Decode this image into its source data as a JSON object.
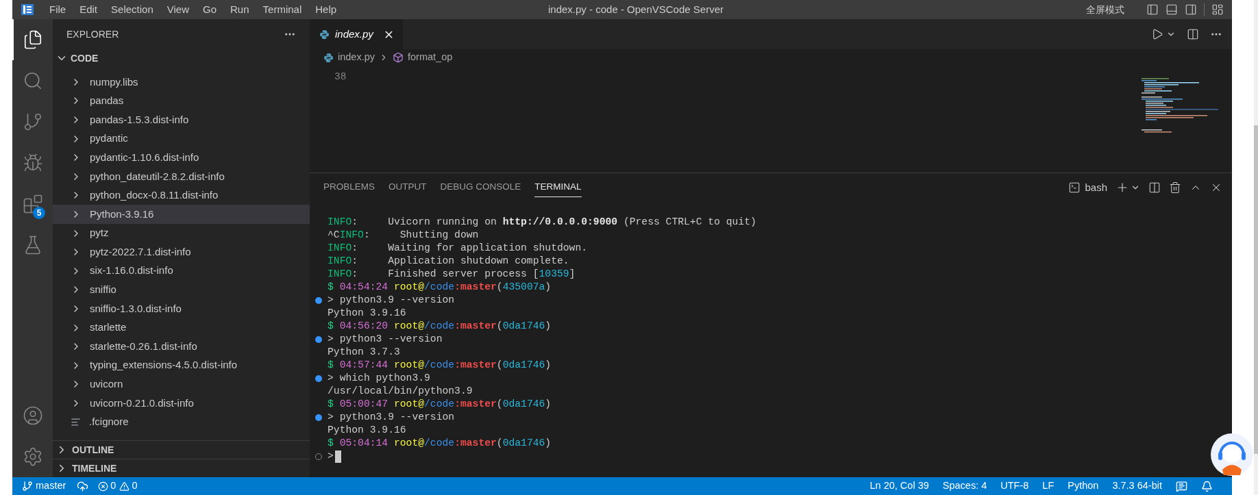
{
  "title_bar": {
    "menu": [
      "File",
      "Edit",
      "Selection",
      "View",
      "Go",
      "Run",
      "Terminal",
      "Help"
    ],
    "title": "index.py - code - OpenVSCode Server",
    "fullscreen_label": "全屏模式"
  },
  "activity_bar": {
    "items": [
      {
        "kind": "explorer",
        "selected": true
      },
      {
        "kind": "search",
        "selected": false
      },
      {
        "kind": "source-control",
        "selected": false
      },
      {
        "kind": "run-debug",
        "selected": false
      },
      {
        "kind": "extensions",
        "selected": false,
        "badge": "5"
      },
      {
        "kind": "testing",
        "selected": false
      }
    ],
    "bottom": [
      {
        "kind": "account"
      },
      {
        "kind": "settings"
      }
    ]
  },
  "sidebar": {
    "title": "EXPLORER",
    "section": "CODE",
    "items": [
      {
        "name": "numpy.libs",
        "kind": "folder",
        "selected": false
      },
      {
        "name": "pandas",
        "kind": "folder",
        "selected": false
      },
      {
        "name": "pandas-1.5.3.dist-info",
        "kind": "folder",
        "selected": false
      },
      {
        "name": "pydantic",
        "kind": "folder",
        "selected": false
      },
      {
        "name": "pydantic-1.10.6.dist-info",
        "kind": "folder",
        "selected": false
      },
      {
        "name": "python_dateutil-2.8.2.dist-info",
        "kind": "folder",
        "selected": false
      },
      {
        "name": "python_docx-0.8.11.dist-info",
        "kind": "folder",
        "selected": false
      },
      {
        "name": "Python-3.9.16",
        "kind": "folder",
        "selected": true
      },
      {
        "name": "pytz",
        "kind": "folder",
        "selected": false
      },
      {
        "name": "pytz-2022.7.1.dist-info",
        "kind": "folder",
        "selected": false
      },
      {
        "name": "six-1.16.0.dist-info",
        "kind": "folder",
        "selected": false
      },
      {
        "name": "sniffio",
        "kind": "folder",
        "selected": false
      },
      {
        "name": "sniffio-1.3.0.dist-info",
        "kind": "folder",
        "selected": false
      },
      {
        "name": "starlette",
        "kind": "folder",
        "selected": false
      },
      {
        "name": "starlette-0.26.1.dist-info",
        "kind": "folder",
        "selected": false
      },
      {
        "name": "typing_extensions-4.5.0.dist-info",
        "kind": "folder",
        "selected": false
      },
      {
        "name": "uvicorn",
        "kind": "folder",
        "selected": false
      },
      {
        "name": "uvicorn-0.21.0.dist-info",
        "kind": "folder",
        "selected": false
      },
      {
        "name": ".fcignore",
        "kind": "file",
        "selected": false
      }
    ],
    "collapsed_sections": [
      "OUTLINE",
      "TIMELINE"
    ]
  },
  "editor": {
    "tabs": [
      {
        "label": "index.py",
        "selected": true
      }
    ],
    "breadcrumb": [
      {
        "label": "index.py",
        "kind": "file"
      },
      {
        "label": "format_op",
        "kind": "symbol"
      }
    ],
    "line_number": "38"
  },
  "panel": {
    "tabs": [
      {
        "label": "PROBLEMS",
        "selected": false
      },
      {
        "label": "OUTPUT",
        "selected": false
      },
      {
        "label": "DEBUG CONSOLE",
        "selected": false
      },
      {
        "label": "TERMINAL",
        "selected": true
      }
    ],
    "terminal_name": "bash",
    "lines": [
      {
        "kind": "output",
        "segments": [
          {
            "text": "INFO",
            "color": "#0dbc79"
          },
          {
            "text": ":     Uvicorn running on ",
            "color": "#cccccc"
          },
          {
            "text": "http://0.0.0.0:9000",
            "color": "#e5e5e5",
            "bold": true
          },
          {
            "text": " (Press CTRL+C to quit)",
            "color": "#cccccc"
          }
        ]
      },
      {
        "kind": "output",
        "segments": [
          {
            "text": "^C",
            "color": "#cccccc"
          },
          {
            "text": "INFO",
            "color": "#0dbc79"
          },
          {
            "text": ":     Shutting down",
            "color": "#cccccc"
          }
        ]
      },
      {
        "kind": "output",
        "segments": [
          {
            "text": "INFO",
            "color": "#0dbc79"
          },
          {
            "text": ":     Waiting for application shutdown.",
            "color": "#cccccc"
          }
        ]
      },
      {
        "kind": "output",
        "segments": [
          {
            "text": "INFO",
            "color": "#0dbc79"
          },
          {
            "text": ":     Application shutdown complete.",
            "color": "#cccccc"
          }
        ]
      },
      {
        "kind": "output",
        "segments": [
          {
            "text": "INFO",
            "color": "#0dbc79"
          },
          {
            "text": ":     Finished server process [",
            "color": "#cccccc"
          },
          {
            "text": "10359",
            "color": "#29b8db"
          },
          {
            "text": "]",
            "color": "#cccccc"
          }
        ]
      },
      {
        "kind": "output",
        "segments": [
          {
            "text": "$ ",
            "color": "#23d18b"
          },
          {
            "text": "04:54:24 ",
            "color": "#d670d6"
          },
          {
            "text": "root@",
            "color": "#f5f543"
          },
          {
            "text": "/code",
            "color": "#3b8eea"
          },
          {
            "text": ":master",
            "color": "#f14c4c",
            "bold": true
          },
          {
            "text": "(",
            "color": "#cccccc"
          },
          {
            "text": "435007a",
            "color": "#29b8db"
          },
          {
            "text": ")",
            "color": "#cccccc"
          }
        ]
      },
      {
        "kind": "command",
        "segments": [
          {
            "text": "> python3.9 --version",
            "color": "#cccccc"
          }
        ]
      },
      {
        "kind": "output",
        "segments": [
          {
            "text": "Python 3.9.16",
            "color": "#cccccc"
          }
        ]
      },
      {
        "kind": "output",
        "segments": [
          {
            "text": "$ ",
            "color": "#23d18b"
          },
          {
            "text": "04:56:20 ",
            "color": "#d670d6"
          },
          {
            "text": "root@",
            "color": "#f5f543"
          },
          {
            "text": "/code",
            "color": "#3b8eea"
          },
          {
            "text": ":master",
            "color": "#f14c4c",
            "bold": true
          },
          {
            "text": "(",
            "color": "#cccccc"
          },
          {
            "text": "0da1746",
            "color": "#29b8db"
          },
          {
            "text": ")",
            "color": "#cccccc"
          }
        ]
      },
      {
        "kind": "command",
        "segments": [
          {
            "text": "> python3 --version",
            "color": "#cccccc"
          }
        ]
      },
      {
        "kind": "output",
        "segments": [
          {
            "text": "Python 3.7.3",
            "color": "#cccccc"
          }
        ]
      },
      {
        "kind": "output",
        "segments": [
          {
            "text": "$ ",
            "color": "#23d18b"
          },
          {
            "text": "04:57:44 ",
            "color": "#d670d6"
          },
          {
            "text": "root@",
            "color": "#f5f543"
          },
          {
            "text": "/code",
            "color": "#3b8eea"
          },
          {
            "text": ":master",
            "color": "#f14c4c",
            "bold": true
          },
          {
            "text": "(",
            "color": "#cccccc"
          },
          {
            "text": "0da1746",
            "color": "#29b8db"
          },
          {
            "text": ")",
            "color": "#cccccc"
          }
        ]
      },
      {
        "kind": "command",
        "segments": [
          {
            "text": "> which python3.9",
            "color": "#cccccc"
          }
        ]
      },
      {
        "kind": "output",
        "segments": [
          {
            "text": "/usr/local/bin/python3.9",
            "color": "#cccccc"
          }
        ]
      },
      {
        "kind": "output",
        "segments": [
          {
            "text": "$ ",
            "color": "#23d18b"
          },
          {
            "text": "05:00:47 ",
            "color": "#d670d6"
          },
          {
            "text": "root@",
            "color": "#f5f543"
          },
          {
            "text": "/code",
            "color": "#3b8eea"
          },
          {
            "text": ":master",
            "color": "#f14c4c",
            "bold": true
          },
          {
            "text": "(",
            "color": "#cccccc"
          },
          {
            "text": "0da1746",
            "color": "#29b8db"
          },
          {
            "text": ")",
            "color": "#cccccc"
          }
        ]
      },
      {
        "kind": "command",
        "segments": [
          {
            "text": "> python3.9 --version",
            "color": "#cccccc"
          }
        ]
      },
      {
        "kind": "output",
        "segments": [
          {
            "text": "Python 3.9.16",
            "color": "#cccccc"
          }
        ]
      },
      {
        "kind": "output",
        "segments": [
          {
            "text": "$ ",
            "color": "#23d18b"
          },
          {
            "text": "05:04:14 ",
            "color": "#d670d6"
          },
          {
            "text": "root@",
            "color": "#f5f543"
          },
          {
            "text": "/code",
            "color": "#3b8eea"
          },
          {
            "text": ":master",
            "color": "#f14c4c",
            "bold": true
          },
          {
            "text": "(",
            "color": "#cccccc"
          },
          {
            "text": "0da1746",
            "color": "#29b8db"
          },
          {
            "text": ")",
            "color": "#cccccc"
          }
        ]
      },
      {
        "kind": "prompt",
        "segments": [
          {
            "text": ">",
            "color": "#cccccc"
          }
        ]
      }
    ]
  },
  "status_bar": {
    "branch": "master",
    "errors": "0",
    "warnings": "0",
    "items": [
      "Ln 20, Col 39",
      "Spaces: 4",
      "UTF-8",
      "LF",
      "Python",
      "3.7.3 64-bit"
    ]
  }
}
